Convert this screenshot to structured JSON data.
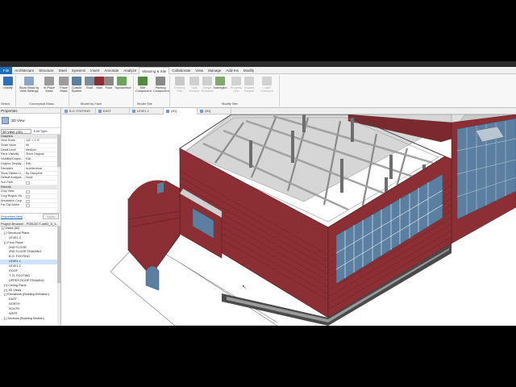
{
  "ribbon": {
    "file_tab": "File",
    "tabs": [
      "Architecture",
      "Structure",
      "Steel",
      "Systems",
      "Insert",
      "Annotate",
      "Analyze",
      "Massing & Site",
      "Collaborate",
      "View",
      "Manage",
      "Add-Ins",
      "Modify"
    ],
    "active_tab": "Massing & Site",
    "buttons": [
      {
        "label": "Modify",
        "enabled": true
      },
      {
        "label": "Show Mass by View Settings",
        "enabled": true
      },
      {
        "label": "In-Place Mass",
        "enabled": true
      },
      {
        "label": "Place Mass",
        "enabled": true
      },
      {
        "label": "Curtain System",
        "enabled": true
      },
      {
        "label": "Roof",
        "enabled": true
      },
      {
        "label": "Wall",
        "enabled": true
      },
      {
        "label": "Floor",
        "enabled": true
      },
      {
        "label": "Toposurface",
        "enabled": true
      },
      {
        "label": "Site Component",
        "enabled": true
      },
      {
        "label": "Parking Component",
        "enabled": true
      },
      {
        "label": "Building Pad",
        "enabled": false
      },
      {
        "label": "Split Surface",
        "enabled": false
      },
      {
        "label": "Merge Surfaces",
        "enabled": false
      },
      {
        "label": "Subregion",
        "enabled": true
      },
      {
        "label": "Property Line",
        "enabled": false
      },
      {
        "label": "Graded Region",
        "enabled": false
      },
      {
        "label": "Label Contours",
        "enabled": false
      }
    ],
    "groups": [
      "Select",
      "Conceptual Mass",
      "Model by Face",
      "Model Site",
      "Modify Site"
    ]
  },
  "properties": {
    "title": "Properties",
    "type_name": "3D View",
    "selector": "3D View: {3D}",
    "edit_type": "Edit Type",
    "category": "Graphics",
    "rows": [
      {
        "key": "View Scale",
        "value": "1/8\" = 1'-0\""
      },
      {
        "key": "Scale Value",
        "value": "96"
      },
      {
        "key": "Detail Level",
        "value": "Medium"
      },
      {
        "key": "Parts Visibility",
        "value": "Show Original"
      },
      {
        "key": "Visibility/Graphi...",
        "value": "Edit..."
      },
      {
        "key": "Graphic Display ...",
        "value": "Edit..."
      },
      {
        "key": "Discipline",
        "value": "Architectural"
      },
      {
        "key": "Show Hidden Li...",
        "value": "By Discipline"
      },
      {
        "key": "Default Analysis...",
        "value": "None"
      },
      {
        "key": "Sun Path",
        "value": ""
      }
    ],
    "extents_category": "Extents",
    "extents_rows": [
      {
        "key": "Crop View",
        "value": ""
      },
      {
        "key": "Crop Region Vis...",
        "value": ""
      },
      {
        "key": "Annotation Crop",
        "value": ""
      },
      {
        "key": "Far Clip Active",
        "value": ""
      }
    ],
    "help_link": "Properties help",
    "apply": "Apply"
  },
  "browser": {
    "title": "Project Browser - FOB-DC7-unit1_5_1...",
    "items": [
      {
        "label": "[-] Views (all)",
        "indent": 0,
        "selected": false
      },
      {
        "label": "[-] Structural Plans",
        "indent": 1,
        "selected": false
      },
      {
        "label": "LEVEL 2",
        "indent": 3,
        "selected": false
      },
      {
        "label": "[-] Floor Plans",
        "indent": 1,
        "selected": false
      },
      {
        "label": "2ND FLOOR",
        "indent": 3,
        "selected": false
      },
      {
        "label": "2ND FLOOR FRAMING",
        "indent": 3,
        "selected": false
      },
      {
        "label": "B.O. FOOTING",
        "indent": 3,
        "selected": false
      },
      {
        "label": "LEVEL 1",
        "indent": 3,
        "selected": true
      },
      {
        "label": "LEVEL 2",
        "indent": 3,
        "selected": false
      },
      {
        "label": "ROOF",
        "indent": 3,
        "selected": false
      },
      {
        "label": "T. O. FOOTING",
        "indent": 3,
        "selected": false
      },
      {
        "label": "UPPER ROOF FRAMING",
        "indent": 3,
        "selected": false
      },
      {
        "label": "[+] Ceiling Plans",
        "indent": 1,
        "selected": false
      },
      {
        "label": "[+] 3D Views",
        "indent": 1,
        "selected": false
      },
      {
        "label": "[-] Elevations (Building Elevation)",
        "indent": 1,
        "selected": false
      },
      {
        "label": "EAST",
        "indent": 3,
        "selected": false
      },
      {
        "label": "NORTH",
        "indent": 3,
        "selected": false
      },
      {
        "label": "SOUTH",
        "indent": 3,
        "selected": false
      },
      {
        "label": "WEST",
        "indent": 3,
        "selected": false
      },
      {
        "label": "[-] Sections (Building Section)",
        "indent": 1,
        "selected": false
      }
    ]
  },
  "view_tabs": [
    {
      "label": "B.O. FOOTING",
      "active": false
    },
    {
      "label": "EAST",
      "active": false
    },
    {
      "label": "LEVEL 1",
      "active": false
    },
    {
      "label": "{3D}",
      "active": true
    },
    {
      "label": "{3D}",
      "active": false
    }
  ],
  "colors": {
    "file_tab": "#1d6fb8",
    "brick": "#8b2f34",
    "brick_dark": "#6a2227",
    "glass": "#5a7fa0",
    "frame": "#9a9a9a",
    "selection": "#cfe3fa"
  }
}
